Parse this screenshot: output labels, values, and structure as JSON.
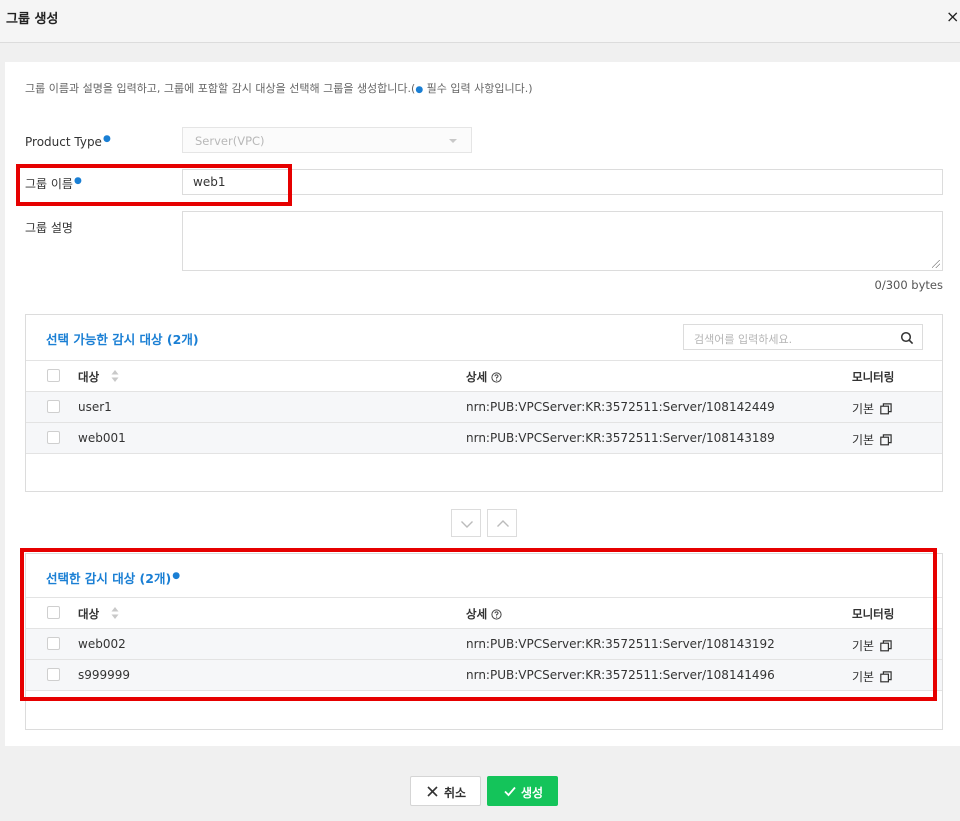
{
  "modal": {
    "title": "그룹 생성",
    "close": "×"
  },
  "intro": {
    "text_before": "그룹 이름과 설명을 입력하고, 그룹에 포함할 감시 대상을 선택해 그룹을 생성합니다.(",
    "dot": "●",
    "text_after": " 필수 입력 사항입니다.)"
  },
  "form": {
    "product_type_label": "Product Type",
    "product_type_value": "Server(VPC)",
    "group_name_label": "그룹 이름",
    "group_name_value": "web1",
    "group_desc_label": "그룹 설명",
    "group_desc_value": "",
    "byte_count": "0/300 bytes",
    "required_mark": "●"
  },
  "available": {
    "title": "선택 가능한 감시 대상 (2개)",
    "search_placeholder": "검색어를 입력하세요.",
    "columns": {
      "target": "대상",
      "detail": "상세",
      "monitoring": "모니터링"
    },
    "rows": [
      {
        "target": "user1",
        "detail": "nrn:PUB:VPCServer:KR:3572511:Server/108142449",
        "monitoring": "기본"
      },
      {
        "target": "web001",
        "detail": "nrn:PUB:VPCServer:KR:3572511:Server/108143189",
        "monitoring": "기본"
      }
    ]
  },
  "selected": {
    "title": "선택한 감시 대상 (2개)",
    "columns": {
      "target": "대상",
      "detail": "상세",
      "monitoring": "모니터링"
    },
    "rows": [
      {
        "target": "web002",
        "detail": "nrn:PUB:VPCServer:KR:3572511:Server/108143192",
        "monitoring": "기본"
      },
      {
        "target": "s999999",
        "detail": "nrn:PUB:VPCServer:KR:3572511:Server/108141496",
        "monitoring": "기본"
      }
    ]
  },
  "footer": {
    "cancel": "취소",
    "create": "생성"
  },
  "colors": {
    "accent_blue": "#1a7fd4",
    "create_green": "#14c45a",
    "highlight_red": "#e60000"
  }
}
